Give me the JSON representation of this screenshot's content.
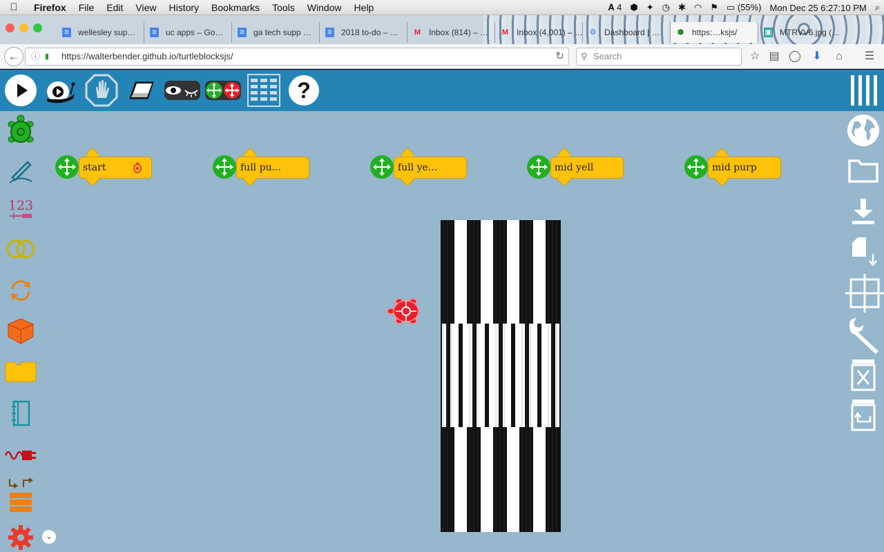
{
  "menubar": {
    "app_name": "Firefox",
    "items": [
      "File",
      "Edit",
      "View",
      "History",
      "Bookmarks",
      "Tools",
      "Window",
      "Help"
    ],
    "status": {
      "adobe": "4",
      "battery": "(55%)",
      "datetime": "Mon Dec 25  6:27:10 PM"
    }
  },
  "browser": {
    "tabs": [
      {
        "title": "wellesley sup…",
        "icon": "doc"
      },
      {
        "title": "uc apps – Go…",
        "icon": "doc"
      },
      {
        "title": "ga tech supp …",
        "icon": "doc"
      },
      {
        "title": "2018 to-do – …",
        "icon": "doc"
      },
      {
        "title": "Inbox (814) – …",
        "icon": "gmail"
      },
      {
        "title": "Inbox (4,001) – …",
        "icon": "gmail"
      },
      {
        "title": "Dashboard | …",
        "icon": "gear"
      },
      {
        "title": "https:…ksjs/",
        "icon": "turtle"
      },
      {
        "title": "MTRVV6.jpg (…",
        "icon": "image"
      }
    ],
    "url": "https://walterbender.github.io/turtleblocksjs/",
    "search_placeholder": "Search"
  },
  "toolbar": {
    "buttons": [
      "play-icon",
      "slow-snail-icon",
      "stop-hand-icon",
      "eraser-icon",
      "hide-blocks-eye-icon",
      "collapse-expand-icon",
      "grid-menu-icon",
      "help-icon"
    ],
    "help_label": "?"
  },
  "palette": {
    "items": [
      "turtle",
      "pen",
      "number",
      "boolean",
      "flow",
      "boxes",
      "action",
      "media",
      "sensors",
      "heap",
      "extras"
    ],
    "number_label": "123"
  },
  "right_toolbar": {
    "items": [
      "main-menu",
      "web",
      "open",
      "save",
      "save-plugin",
      "coordinate-grid",
      "settings-wrench",
      "clear",
      "restore-trash"
    ]
  },
  "canvas": {
    "start_blocks": [
      {
        "label": "start",
        "has_turtle": true
      },
      {
        "label": "full pu..."
      },
      {
        "label": "full ye..."
      },
      {
        "label": "mid yell"
      },
      {
        "label": "mid purp"
      }
    ],
    "turtle_color": "#e8202a"
  },
  "colors": {
    "toolbar": "#2484b6",
    "canvas": "#96b7cc",
    "block": "#fec20b",
    "mover": "#22b022"
  }
}
